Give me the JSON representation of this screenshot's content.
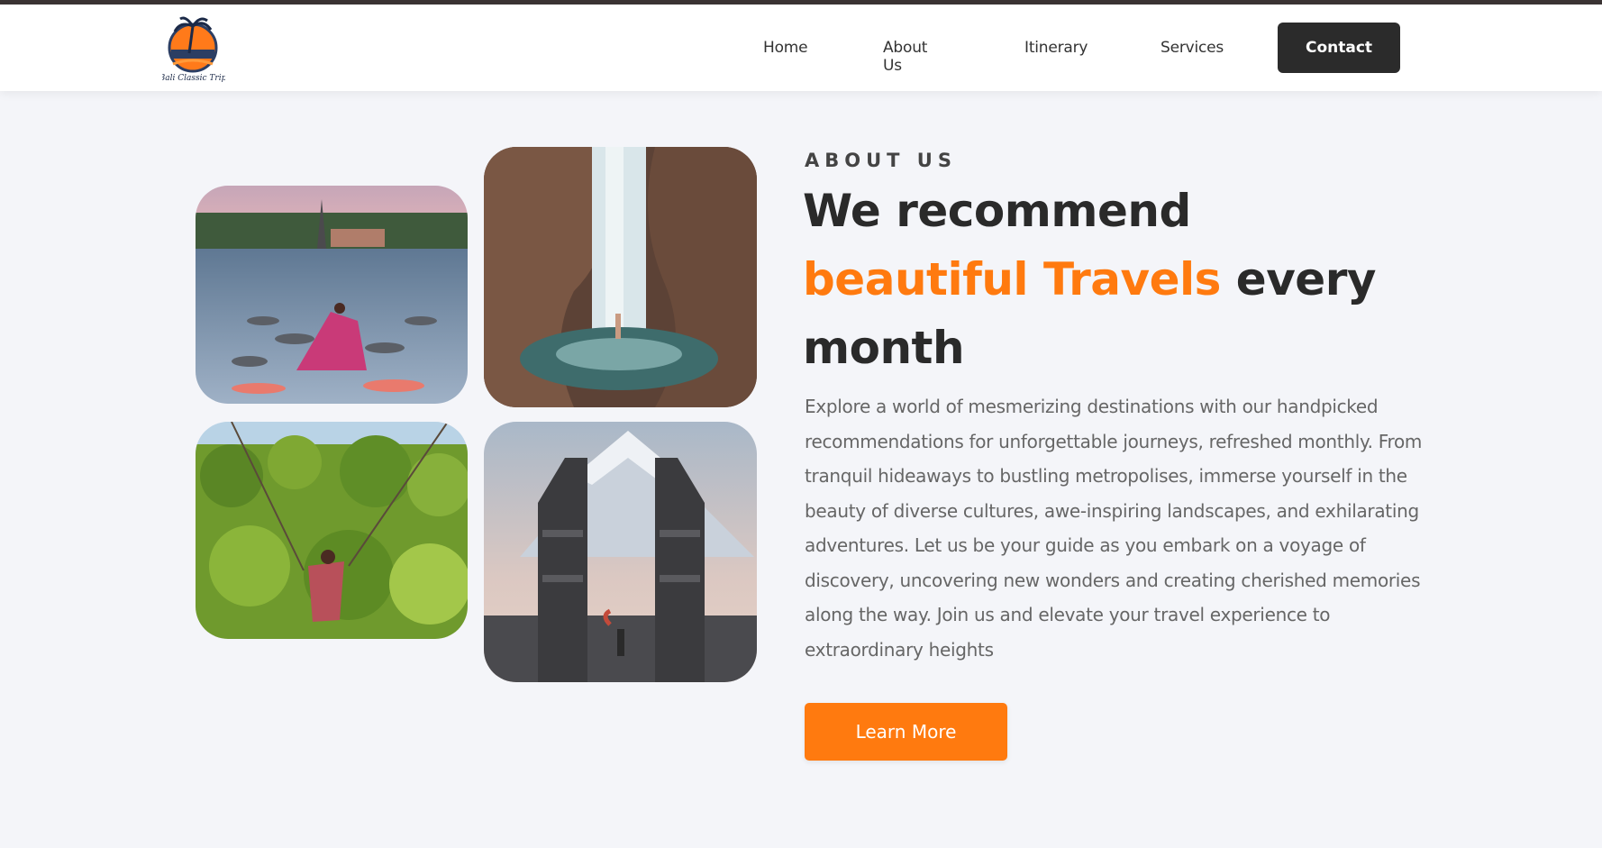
{
  "header": {
    "logo_name": "palm-sunset-logo",
    "logo_text": "Bali Classic Trip",
    "nav": [
      {
        "label": "Home"
      },
      {
        "label": "About Us"
      },
      {
        "label": "Itinerary"
      },
      {
        "label": "Services"
      }
    ],
    "contact_label": "Contact"
  },
  "about": {
    "eyebrow": "ABOUT US",
    "headline_line1": "We recommend",
    "headline_accent": "beautiful Travels",
    "headline_rest": " every month",
    "description": "Explore a world of mesmerizing destinations with our handpicked recommendations for unforgettable journeys, refreshed monthly. From tranquil hideaways to bustling metropolises, immerse yourself in the beauty of diverse cultures, awe-inspiring landscapes, and exhilarating adventures. Let us be your guide as you embark on a voyage of discovery, uncovering new wonders and creating cherished memories along the way. Join us and elevate your travel experience to extraordinary heights",
    "cta_label": "Learn More"
  },
  "colors": {
    "accent": "#ff7a0f",
    "dark": "#2b2b2b",
    "background": "#f4f5f9"
  }
}
